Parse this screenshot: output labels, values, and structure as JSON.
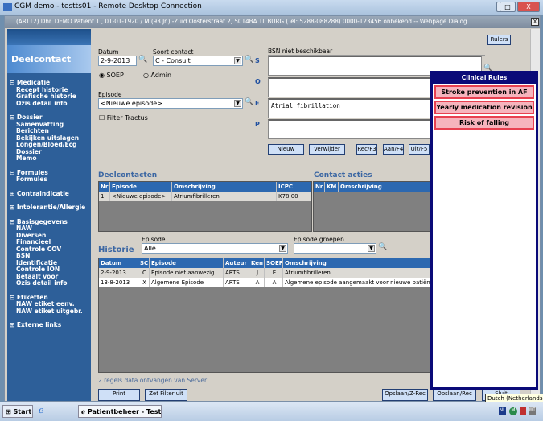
{
  "window": {
    "title": "CGM demo - testts01 - Remote Desktop Connection",
    "minimize": "–",
    "maximize": "□",
    "close": "X"
  },
  "dialog": {
    "title": "(ART12) Dhr. DEMO Patient T , 01-01-1920 / M (93 Jr.) -Zuid Oosterstraat 2, 5014BA TILBURG (Tel: 5288-088288) 0000-123456 onbekend -- Webpage Dialog",
    "close": "X",
    "rulers_button": "Rulers"
  },
  "sidebar": {
    "header": "Deelcontact",
    "sections": [
      {
        "title": "Medicatie",
        "items": [
          "Recept historie",
          "Grafische historie",
          "Ozis detail info"
        ]
      },
      {
        "title": "Dossier",
        "items": [
          "Samenvatting",
          "Berichten",
          "Bekijken uitslagen",
          "Longen/Bloed/Ecg",
          "Dossier",
          "Memo"
        ]
      },
      {
        "title": "Formules",
        "items": [
          "Formules"
        ]
      },
      {
        "title": "Contraindicatie",
        "items": []
      },
      {
        "title": "Intolerantie/Allergie",
        "items": []
      },
      {
        "title": "Basisgegevens",
        "items": [
          "NAW",
          "Diversen",
          "Financieel",
          "Controle COV",
          "BSN",
          "Identificatie",
          "Controle ION",
          "Betaalt voor",
          "Ozis detail info"
        ]
      },
      {
        "title": "Etiketten",
        "items": [
          "NAW etiket eenv.",
          "NAW etiket uitgebr."
        ]
      },
      {
        "title": "Externe links",
        "items": []
      }
    ]
  },
  "form": {
    "datum_label": "Datum",
    "datum_value": "2-9-2013",
    "soort_label": "Soort contact",
    "soort_value": "C - Consult",
    "radio_soep": "SOEP",
    "radio_admin": "Admin",
    "episode_label": "Episode",
    "episode_value": "<Nieuwe episode>",
    "filter_tractus": "Filter Tractus",
    "bsn_label": "BSN niet beschikbaar",
    "s": "S",
    "o": "O",
    "e": "E",
    "p": "P",
    "s_text": "",
    "o_text": "",
    "e_text": "Atrial fibrillation",
    "p_text": ""
  },
  "buttons": {
    "nieuw": "Nieuw",
    "verwijder": "Verwijder",
    "rec": "Rec/F3",
    "aan": "Aan/F4",
    "uit": "Uit/F5",
    "print": "Print",
    "filter": "Zet Filter uit",
    "opslaan_z": "Opslaan/Z-Rec",
    "opslaan": "Opslaan/Rec",
    "sluit": "Sluit"
  },
  "deelcontacten": {
    "title": "Deelcontacten",
    "columns": [
      "Nr",
      "Episode",
      "Omschrijving",
      "ICPC"
    ],
    "rows": [
      [
        "1",
        "<Nieuwe episode>",
        "Atriumfibrilleren",
        "K78.00"
      ]
    ]
  },
  "contact_acties": {
    "title": "Contact acties",
    "columns": [
      "Nr",
      "KM",
      "Omschrijving"
    ],
    "rows": []
  },
  "historie": {
    "title": "Historie",
    "episode_label": "Episode",
    "episode_value": "Alle",
    "groepen_label": "Episode groepen",
    "groepen_value": "",
    "columns": [
      "Datum",
      "SC",
      "Episode",
      "Auteur",
      "Ken",
      "SOEP",
      "Omschrijving"
    ],
    "rows": [
      [
        "2-9-2013",
        "C",
        "Episode niet aanwezig",
        "ARTS",
        "J",
        "E",
        "Atriumfibrilleren"
      ],
      [
        "13-8-2013",
        "X",
        "Algemene Episode",
        "ARTS",
        "A",
        "A",
        "Algemene episode aangemaakt voor nieuwe patiënt"
      ]
    ]
  },
  "status": "2 regels data ontvangen van Server",
  "clinical_rules": {
    "title": "Clinical Rules",
    "items": [
      "Stroke prevention in AF",
      "Yearly medication revision",
      "Risk of falling"
    ],
    "color": "#f6b4bd",
    "border": "#e84050"
  },
  "tooltip": "Dutch (Netherlands)",
  "taskbar": {
    "start": "Start",
    "task": "Patientbeheer - Test...",
    "tray": [
      "NL",
      "M",
      "notification",
      "WT"
    ]
  }
}
